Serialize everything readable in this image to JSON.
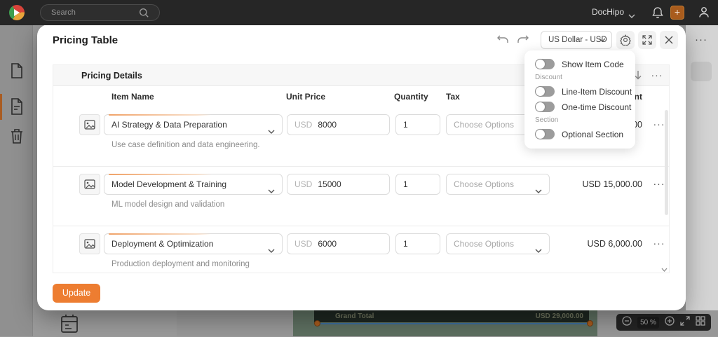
{
  "topbar": {
    "search_placeholder": "Search",
    "brand": "DocHipo",
    "plus_label": "+"
  },
  "sidebar": {
    "items": [
      {
        "icon": "document-icon"
      },
      {
        "icon": "document-lines-icon",
        "active": true
      },
      {
        "icon": "trash-icon"
      }
    ]
  },
  "modal": {
    "title": "Pricing Table",
    "currency_selector": "US Dollar - USD",
    "table": {
      "section_title": "Pricing Details",
      "columns": {
        "item": "Item Name",
        "unit_price": "Unit Price",
        "quantity": "Quantity",
        "tax": "Tax",
        "amount": "Amount"
      },
      "rows": [
        {
          "item": "AI Strategy & Data Preparation",
          "currency": "USD",
          "unit_price": "8000",
          "quantity": "1",
          "tax_placeholder": "Choose Options",
          "amount": "USD 8,000.00",
          "description": "Use case definition and data engineering.",
          "menu": "···"
        },
        {
          "item": "Model Development & Training",
          "currency": "USD",
          "unit_price": "15000",
          "quantity": "1",
          "tax_placeholder": "Choose Options",
          "amount": "USD 15,000.00",
          "description": "ML model design and validation",
          "menu": "···"
        },
        {
          "item": "Deployment & Optimization",
          "currency": "USD",
          "unit_price": "6000",
          "quantity": "1",
          "tax_placeholder": "Choose Options",
          "amount": "USD 6,000.00",
          "description": "Production deployment and monitoring",
          "menu": "···"
        }
      ],
      "band_menu": "···"
    },
    "update_button": "Update"
  },
  "settings_popover": {
    "show_item_code": "Show Item Code",
    "discount_section": "Discount",
    "line_item_discount": "Line-Item Discount",
    "one_time_discount": "One-time Discount",
    "section_section": "Section",
    "optional_section": "Optional Section",
    "toggle_states": {
      "show_item_code": "off",
      "line_item_discount": "off",
      "one_time_discount": "off",
      "optional_section": "off"
    }
  },
  "canvas": {
    "grand_total_label": "Grand Total",
    "grand_total_value": "USD 29,000.00",
    "zoom_value": "50 %"
  },
  "right_strip": {
    "menu": "···"
  },
  "colors": {
    "accent_orange": "#ED7D31",
    "topbar_bg": "#262626",
    "toggle_track_off": "#9C9C9C",
    "canvas_page_green": "#5D6F60",
    "grand_total_bar": "#1D2620",
    "selection_blue": "#3C6E9E"
  }
}
